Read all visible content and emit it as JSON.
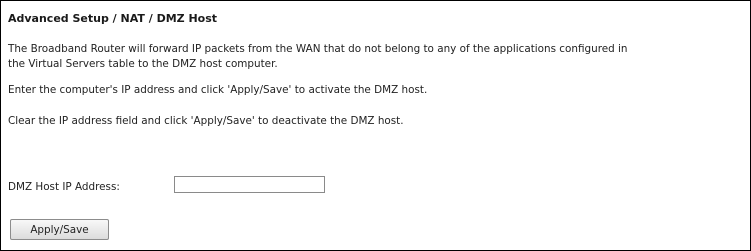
{
  "page": {
    "title": "Advanced Setup / NAT / DMZ Host"
  },
  "description": {
    "line1": "The Broadband Router will forward IP packets from the WAN that do not belong to any of the applications configured in",
    "line2": "the Virtual Servers table to the DMZ host computer.",
    "activate": "Enter the computer's IP address and click 'Apply/Save' to activate the DMZ host.",
    "deactivate": "Clear the IP address field and click 'Apply/Save' to deactivate the DMZ host."
  },
  "form": {
    "ip_label": "DMZ Host IP Address:",
    "ip_value": "",
    "apply_label": "Apply/Save"
  }
}
